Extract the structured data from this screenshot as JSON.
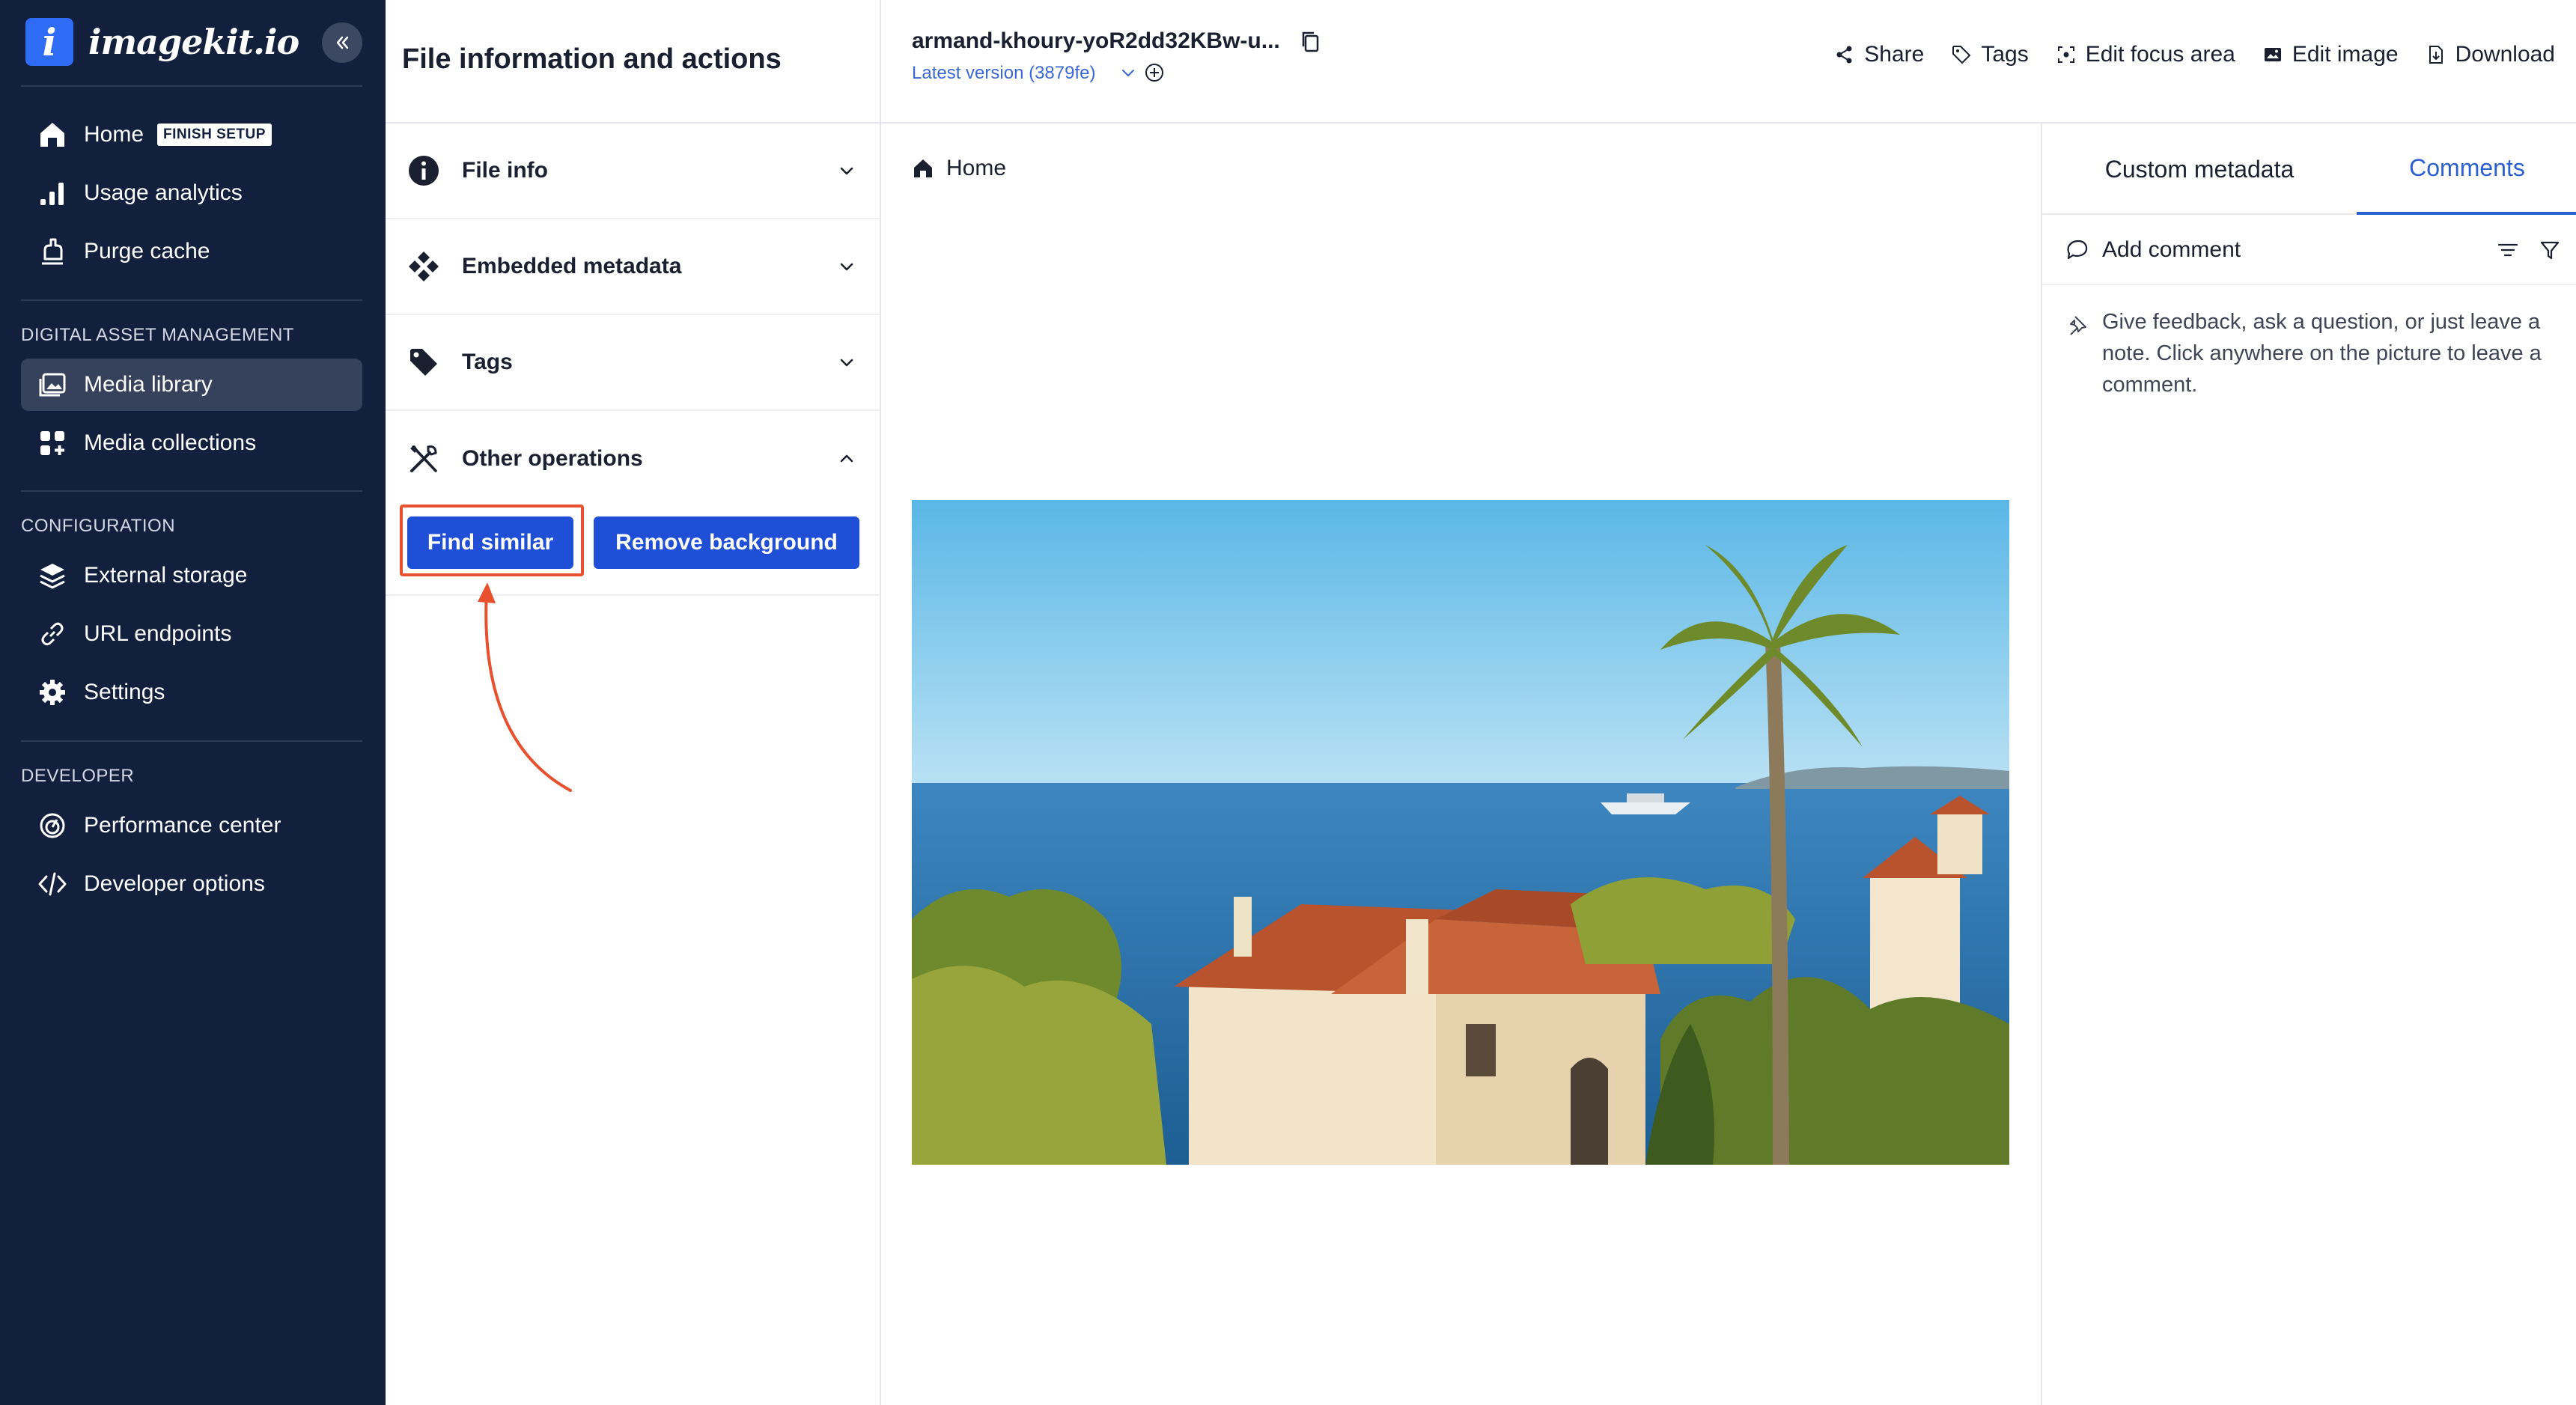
{
  "sidebar": {
    "logo_mark": "i",
    "logo_text": "imagekit.io",
    "home": {
      "label": "Home",
      "badge": "FINISH SETUP"
    },
    "top_items": [
      {
        "label": "Usage analytics"
      },
      {
        "label": "Purge cache"
      }
    ],
    "sections": {
      "dam": "DIGITAL ASSET MANAGEMENT",
      "config": "CONFIGURATION",
      "developer": "DEVELOPER"
    },
    "dam_items": [
      {
        "label": "Media library",
        "active": true
      },
      {
        "label": "Media collections"
      }
    ],
    "config_items": [
      {
        "label": "External storage"
      },
      {
        "label": "URL endpoints"
      },
      {
        "label": "Settings"
      }
    ],
    "developer_items": [
      {
        "label": "Performance center"
      },
      {
        "label": "Developer options"
      }
    ]
  },
  "info_panel": {
    "title": "File information and actions",
    "accordions": [
      {
        "label": "File info",
        "icon": "info-icon",
        "expanded": false
      },
      {
        "label": "Embedded metadata",
        "icon": "diamond-grid-icon",
        "expanded": false
      },
      {
        "label": "Tags",
        "icon": "tag-icon",
        "expanded": false
      },
      {
        "label": "Other operations",
        "icon": "tools-icon",
        "expanded": true
      }
    ],
    "operations": {
      "find_similar": "Find similar",
      "remove_background": "Remove background"
    }
  },
  "topbar": {
    "file_name": "armand-khoury-yoR2dd32KBw-u...",
    "version": "Latest version (3879fe)",
    "actions": {
      "share": "Share",
      "tags": "Tags",
      "edit_focus": "Edit focus area",
      "edit_image": "Edit image",
      "download": "Download"
    }
  },
  "breadcrumb": {
    "home": "Home"
  },
  "right_panel": {
    "tabs": {
      "custom_metadata": "Custom metadata",
      "comments": "Comments"
    },
    "active_tab": "Comments",
    "add_comment": "Add comment",
    "hint": "Give feedback, ask a question, or just leave a note. Click anywhere on the picture to leave a comment."
  },
  "colors": {
    "sidebar_bg": "#13203d",
    "primary_button": "#1f4fd6",
    "accent_link": "#2c5fd0",
    "annotation_red": "#e8502e"
  }
}
